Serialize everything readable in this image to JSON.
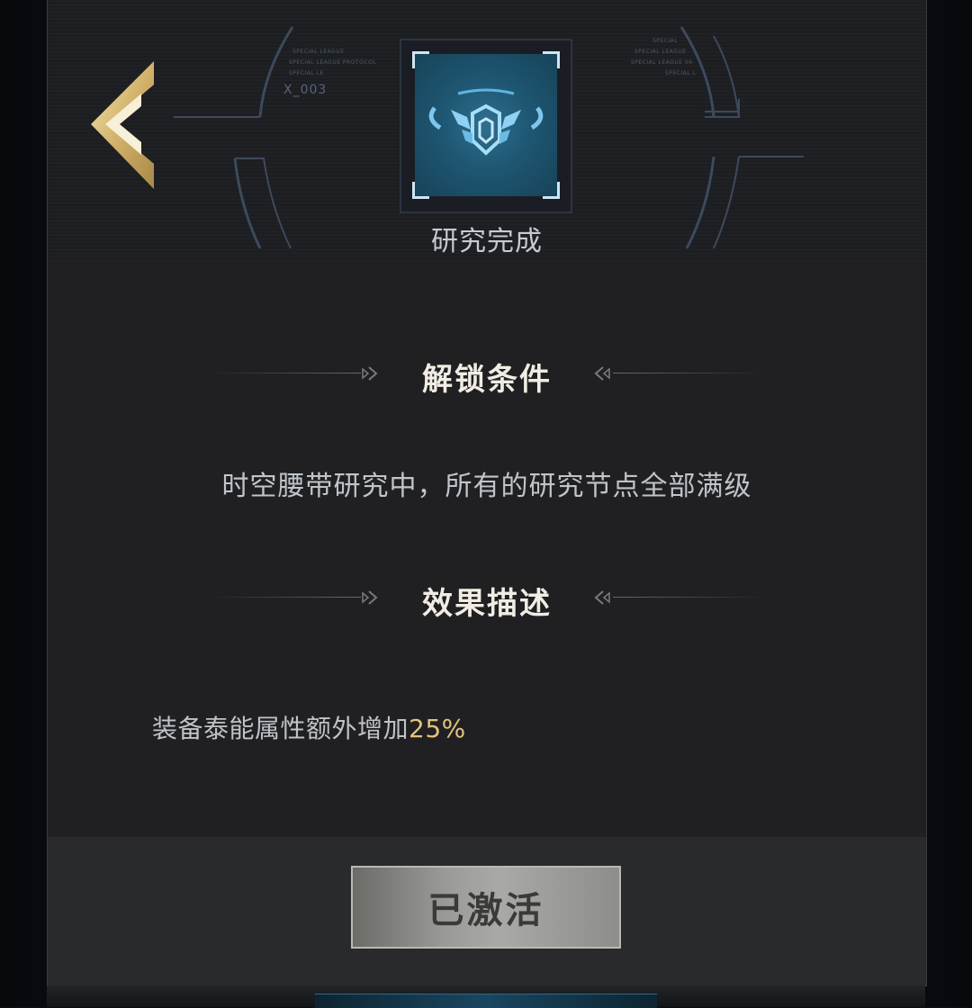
{
  "header": {
    "code_label": "X_003",
    "tiny_left": [
      "SPECIAL LEAGUE",
      "SPECIAL LEAGUE PROTOCOL",
      "SPECIAL LE"
    ],
    "tiny_right": [
      "SPECIAL",
      "SPECIAL LEAGUE",
      "SPECIAL LEAGUE 06",
      "SPECIAL L"
    ],
    "icon": "belt-emblem-icon",
    "status": "研究完成"
  },
  "unlock": {
    "title": "解锁条件",
    "text": "时空腰带研究中，所有的研究节点全部满级"
  },
  "effect": {
    "title": "效果描述",
    "text": "装备泰能属性额外增加",
    "value": "25%"
  },
  "footer": {
    "button_label": "已激活"
  },
  "colors": {
    "accent_gold": "#e2c27a",
    "icon_blue": "#2f7090",
    "panel_bg": "#202022"
  }
}
